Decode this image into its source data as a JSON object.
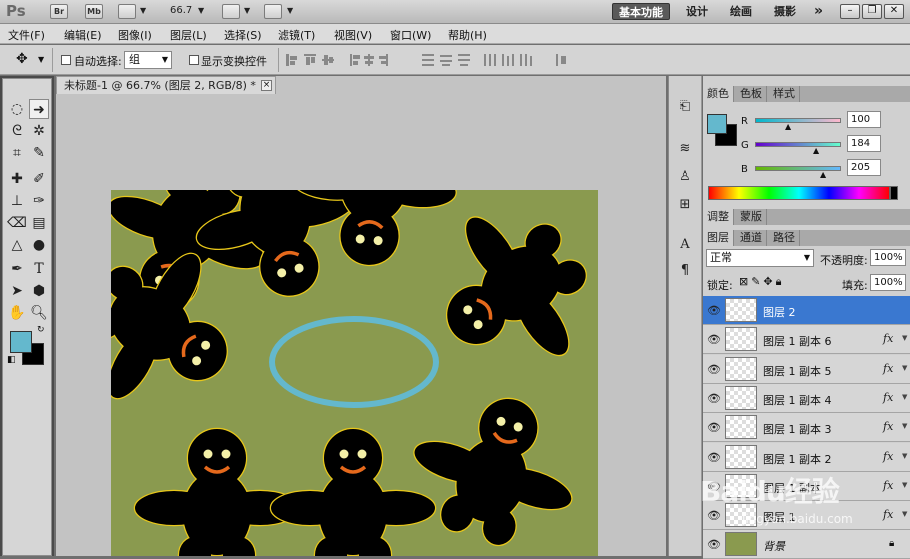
{
  "app": {
    "logo": "Ps",
    "br": "Br",
    "mb": "Mb",
    "zoom": "66.7"
  },
  "workspace": {
    "basic": "基本功能",
    "design": "设计",
    "paint": "绘画",
    "photo": "摄影",
    "more": "»"
  },
  "menu": [
    "文件(F)",
    "编辑(E)",
    "图像(I)",
    "图层(L)",
    "选择(S)",
    "滤镜(T)",
    "视图(V)",
    "窗口(W)",
    "帮助(H)"
  ],
  "options": {
    "auto_select_label": "自动选择:",
    "auto_select_value": "组",
    "show_transform_label": "显示变换控件"
  },
  "document": {
    "tab_title": "未标题-1 @ 66.7% (图层 2, RGB/8) *",
    "close": "×"
  },
  "color_panel": {
    "tabs": [
      "颜色",
      "色板",
      "样式"
    ],
    "r_label": "R",
    "g_label": "G",
    "b_label": "B",
    "r": "100",
    "g": "184",
    "b": "205",
    "foreground": "#64b8cd",
    "background": "#000000"
  },
  "adjust_tabs": [
    "调整",
    "蒙版"
  ],
  "layers_panel": {
    "tabs": [
      "图层",
      "通道",
      "路径"
    ],
    "blend_mode": "正常",
    "opacity_label": "不透明度:",
    "opacity": "100%",
    "lock_label": "锁定:",
    "fill_label": "填充:",
    "fill": "100%",
    "layers": [
      {
        "name": "图层 2",
        "fx": "",
        "selected": true,
        "type": "transparent"
      },
      {
        "name": "图层 1 副本 6",
        "fx": "fx",
        "selected": false,
        "type": "transparent"
      },
      {
        "name": "图层 1 副本 5",
        "fx": "fx",
        "selected": false,
        "type": "transparent"
      },
      {
        "name": "图层 1 副本 4",
        "fx": "fx",
        "selected": false,
        "type": "transparent"
      },
      {
        "name": "图层 1 副本 3",
        "fx": "fx",
        "selected": false,
        "type": "transparent"
      },
      {
        "name": "图层 1 副本 2",
        "fx": "fx",
        "selected": false,
        "type": "transparent"
      },
      {
        "name": "图层 1 副本",
        "fx": "fx",
        "selected": false,
        "type": "transparent"
      },
      {
        "name": "图层 1",
        "fx": "fx",
        "selected": false,
        "type": "transparent"
      },
      {
        "name": "背景",
        "fx": "",
        "selected": false,
        "type": "background"
      }
    ]
  },
  "watermark": {
    "main": "Baidu经验",
    "sub": "jingyan.baidu.com"
  }
}
